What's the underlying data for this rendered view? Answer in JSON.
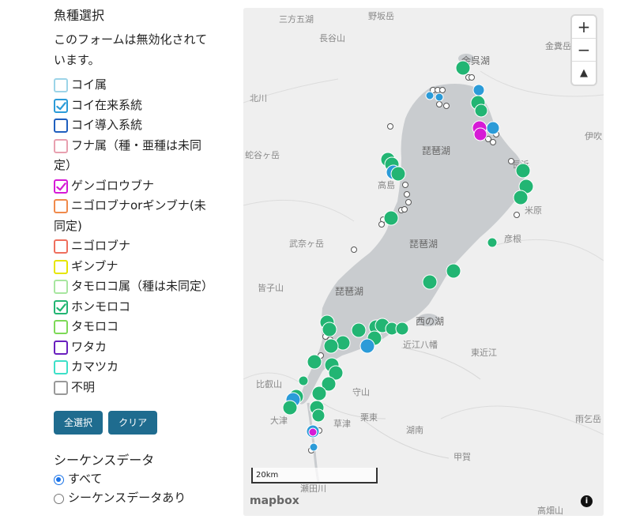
{
  "panel": {
    "species_title": "魚種選択",
    "notice_line1": "このフォームは無効化されて",
    "notice_line2": "います。",
    "species": [
      {
        "label": "コイ属",
        "color": "#9cd4e8",
        "checked": false,
        "lines": [
          "コイ属"
        ]
      },
      {
        "label": "コイ在来系統",
        "color": "#2b9bd8",
        "checked": true,
        "lines": [
          "コイ在来系統"
        ]
      },
      {
        "label": "コイ導入系統",
        "color": "#1f5fbf",
        "checked": false,
        "lines": [
          "コイ導入系統"
        ]
      },
      {
        "label": "フナ属（種・亜種は未同定）",
        "color": "#e8a0b0",
        "checked": false,
        "lines": [
          "フナ属（種・亜種は未同",
          "定）"
        ]
      },
      {
        "label": "ゲンゴロウブナ",
        "color": "#d61ad6",
        "checked": true,
        "lines": [
          "ゲンゴロウブナ"
        ]
      },
      {
        "label": "ニゴロブナorギンブナ(未同定)",
        "color": "#f08a4b",
        "checked": false,
        "lines": [
          "ニゴロブナorギンブナ(未",
          "同定)"
        ]
      },
      {
        "label": "ニゴロブナ",
        "color": "#ef6f5e",
        "checked": false,
        "lines": [
          "ニゴロブナ"
        ]
      },
      {
        "label": "ギンブナ",
        "color": "#e6e600",
        "checked": false,
        "lines": [
          "ギンブナ"
        ]
      },
      {
        "label": "タモロコ属（種は未同定）",
        "color": "#a8e6a0",
        "checked": false,
        "lines": [
          "タモロコ属（種は未同定）"
        ]
      },
      {
        "label": "ホンモロコ",
        "color": "#22b573",
        "checked": true,
        "lines": [
          "ホンモロコ"
        ]
      },
      {
        "label": "タモロコ",
        "color": "#7ed957",
        "checked": false,
        "lines": [
          "タモロコ"
        ]
      },
      {
        "label": "ワタカ",
        "color": "#6a1fbf",
        "checked": false,
        "lines": [
          "ワタカ"
        ]
      },
      {
        "label": "カマツカ",
        "color": "#3de0c8",
        "checked": false,
        "lines": [
          "カマツカ"
        ]
      },
      {
        "label": "不明",
        "color": "#999999",
        "checked": false,
        "lines": [
          "不明"
        ]
      }
    ],
    "select_all_label": "全選択",
    "clear_label": "クリア",
    "sequence_title": "シーケンスデータ",
    "sequence_options": [
      {
        "label": "すべて",
        "selected": true
      },
      {
        "label": "シーケンスデータあり",
        "selected": false
      }
    ]
  },
  "map": {
    "zoom_in": "+",
    "zoom_out": "−",
    "compass": "▲",
    "scale_label": "20km",
    "attribution": "mapbox",
    "info": "i",
    "lake_color": "#c9cccf",
    "land_color": "#efefef",
    "labels": [
      {
        "id": "sanpoui",
        "text": "三方五湖"
      },
      {
        "id": "nosaka",
        "text": "野坂岳"
      },
      {
        "id": "aotani",
        "text": "長谷山"
      },
      {
        "id": "yogo",
        "text": "余呉湖"
      },
      {
        "id": "kanamiya",
        "text": "金糞岳"
      },
      {
        "id": "kitakawa",
        "text": "北川"
      },
      {
        "id": "ibuki",
        "text": "伊吹"
      },
      {
        "id": "biwako1",
        "text": "琵琶湖"
      },
      {
        "id": "nagahama",
        "text": "長浜"
      },
      {
        "id": "takashima",
        "text": "高島"
      },
      {
        "id": "maibara",
        "text": "米原"
      },
      {
        "id": "hiragaoka",
        "text": "蛇谷ヶ岳"
      },
      {
        "id": "bukagatake",
        "text": "武奈ヶ岳"
      },
      {
        "id": "biwako2",
        "text": "琵琶湖"
      },
      {
        "id": "hikone",
        "text": "彦根"
      },
      {
        "id": "shakushi",
        "text": "皆子山"
      },
      {
        "id": "biwako3",
        "text": "琵琶湖"
      },
      {
        "id": "nishinoko",
        "text": "西の湖"
      },
      {
        "id": "omihachiman",
        "text": "近江八幡"
      },
      {
        "id": "higashiomi",
        "text": "東近江"
      },
      {
        "id": "hiei",
        "text": "比叡山"
      },
      {
        "id": "moriyama",
        "text": "守山"
      },
      {
        "id": "ritto",
        "text": "栗東"
      },
      {
        "id": "kusatsu",
        "text": "草津"
      },
      {
        "id": "otsu",
        "text": "大津"
      },
      {
        "id": "konan",
        "text": "湖南"
      },
      {
        "id": "amagoigatake",
        "text": "雨乞岳"
      },
      {
        "id": "koka",
        "text": "甲賀"
      },
      {
        "id": "setagawa",
        "text": "瀬田川"
      },
      {
        "id": "takahatayama",
        "text": "高畑山"
      }
    ]
  }
}
